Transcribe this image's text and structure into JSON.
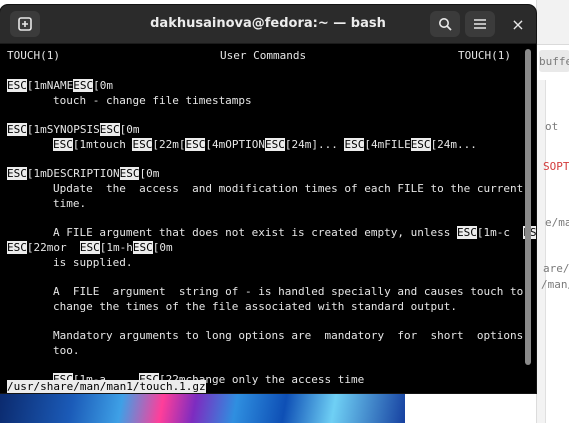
{
  "window": {
    "title": "dakhusainova@fedora:~ — bash",
    "close_glyph": "×"
  },
  "man": {
    "header_left": "TOUCH(1)",
    "header_center": "User Commands",
    "header_right": "TOUCH(1)",
    "esc": "ESC",
    "lines": {
      "name_head_a": "[1mNAME",
      "name_head_b": "[0m",
      "name_body": "touch - change file timestamps",
      "syn_head_a": "[1mSYNOPSIS",
      "syn_head_b": "[0m",
      "syn_a": "[1mtouch ",
      "syn_b": "[22m[",
      "syn_c": "[4mOPTION",
      "syn_d": "[24m]... ",
      "syn_e": "[4mFILE",
      "syn_f": "[24m...",
      "desc_head_a": "[1mDESCRIPTION",
      "desc_head_b": "[0m",
      "desc1": "Update  the  access  and modification times of each FILE to the current",
      "desc2": "time.",
      "desc3": "A FILE argument that does not exist is created empty, unless ",
      "desc3_b": "[1m-c  ",
      "desc4_a": "[22mor  ",
      "desc4_b": "[1m-h",
      "desc4_c": "[0m",
      "desc5": "is supplied.",
      "desc6": "A  FILE  argument  string of - is handled specially and causes touch to",
      "desc7": "change the times of the file associated with standard output.",
      "desc8": "Mandatory arguments to long options are  mandatory  for  short  options",
      "desc9": "too.",
      "opt_a": "[1m-a     ",
      "opt_b": "[22mchange only the access time"
    },
    "status_line": "/usr/share/man/man1/touch.1.gz"
  },
  "background_window": {
    "text1": "buffers",
    "text2": "ot",
    "text3": "SOPTAR",
    "text4": "e/man/",
    "text5": "are/man",
    "text6": "/man/n"
  },
  "icons": [
    "new-tab-icon",
    "search-icon",
    "hamburger-menu-icon",
    "close-icon"
  ]
}
